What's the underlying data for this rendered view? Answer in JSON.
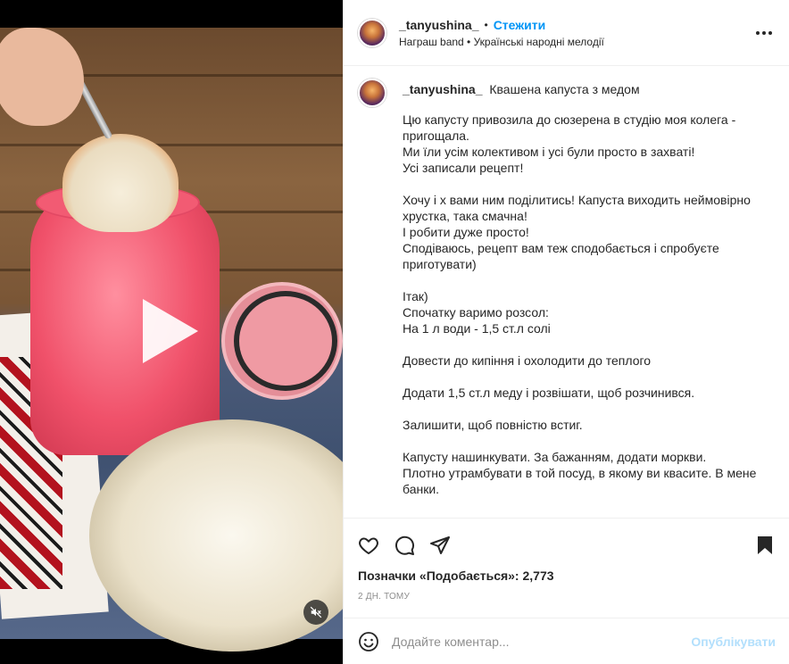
{
  "header": {
    "username": "_tanyushina_",
    "separator": "•",
    "follow_label": "Стежити",
    "audio": "Награш band • Українські народні мелодії",
    "more_icon": "more-horizontal-icon"
  },
  "caption": {
    "username": "_tanyushina_",
    "title": "Квашена капуста з медом",
    "paragraphs": [
      "Цю капусту привозила до сюзерена в студію моя колега - пригощала.\nМи їли усім колективом і усі були просто в захваті!\nУсі записали рецепт!",
      "Хочу і х вами ним поділитись! Капуста виходить неймовірно хрустка, така смачна!\nІ робити дуже просто!\nСподіваюсь, рецепт вам теж сподобається і спробуєте приготувати)",
      "Ітак)\nСпочатку варимо розсол:\nНа 1 л води - 1,5 ст.л солі",
      "Довести до кипіння і охолодити до теплого",
      "Додати 1,5 ст.л меду і розвішати, щоб розчинився.",
      "Залишити, щоб повністю встиг.",
      "Капусту нашинкувати. За бажанням, додати моркви.\nПлотно утрамбувати в той посуд, в якому ви квасите. В мене банки."
    ]
  },
  "actions": {
    "likes_text": "Позначки «Подобається»: 2,773",
    "time": "2 ДН. ТОМУ"
  },
  "comment": {
    "placeholder": "Додайте коментар...",
    "publish_label": "Опублікувати"
  },
  "colors": {
    "accent": "#0095f6",
    "publish_disabled": "#b2dffc",
    "muted": "#8e8e8e"
  }
}
